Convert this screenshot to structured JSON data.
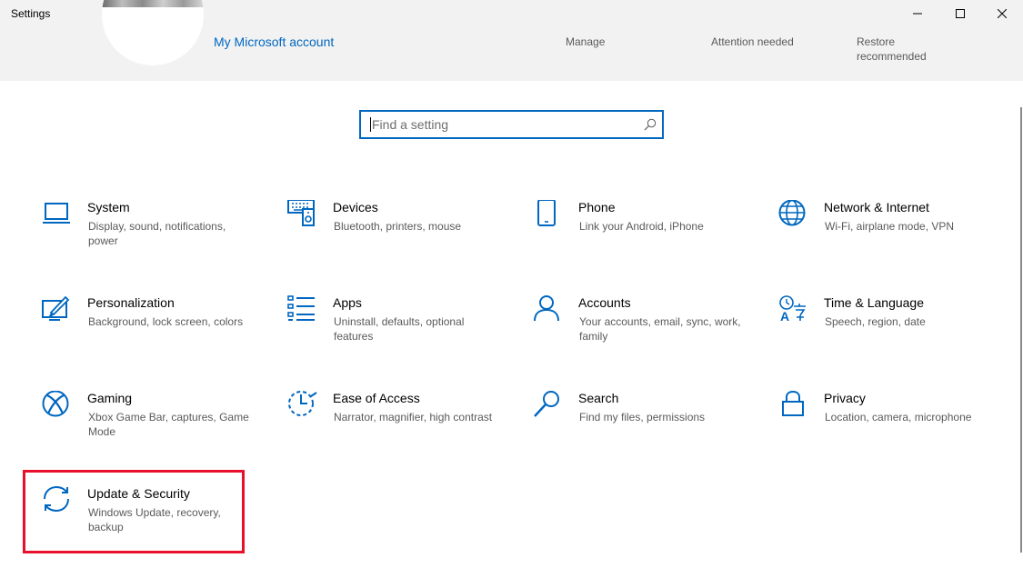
{
  "window": {
    "title": "Settings"
  },
  "header": {
    "account_link": "My Microsoft account",
    "items": [
      {
        "label": "Manage"
      },
      {
        "label": "Attention needed"
      },
      {
        "label": "Restore recommended"
      }
    ]
  },
  "search": {
    "placeholder": "Find a setting",
    "value": ""
  },
  "tiles": [
    {
      "title": "System",
      "description": "Display, sound, notifications, power",
      "icon": "laptop-icon"
    },
    {
      "title": "Devices",
      "description": "Bluetooth, printers, mouse",
      "icon": "devices-icon"
    },
    {
      "title": "Phone",
      "description": "Link your Android, iPhone",
      "icon": "phone-icon"
    },
    {
      "title": "Network & Internet",
      "description": "Wi-Fi, airplane mode, VPN",
      "icon": "globe-icon"
    },
    {
      "title": "Personalization",
      "description": "Background, lock screen, colors",
      "icon": "paint-icon"
    },
    {
      "title": "Apps",
      "description": "Uninstall, defaults, optional features",
      "icon": "apps-list-icon"
    },
    {
      "title": "Accounts",
      "description": "Your accounts, email, sync, work, family",
      "icon": "person-icon"
    },
    {
      "title": "Time & Language",
      "description": "Speech, region, date",
      "icon": "time-language-icon"
    },
    {
      "title": "Gaming",
      "description": "Xbox Game Bar, captures, Game Mode",
      "icon": "xbox-icon"
    },
    {
      "title": "Ease of Access",
      "description": "Narrator, magnifier, high contrast",
      "icon": "ease-of-access-icon"
    },
    {
      "title": "Search",
      "description": "Find my files, permissions",
      "icon": "magnifier-icon"
    },
    {
      "title": "Privacy",
      "description": "Location, camera, microphone",
      "icon": "lock-icon"
    },
    {
      "title": "Update & Security",
      "description": "Windows Update, recovery, backup",
      "icon": "sync-icon"
    }
  ],
  "colors": {
    "accent": "#0067c0",
    "highlight": "#e8112d",
    "header_bg": "#f2f2f2"
  }
}
